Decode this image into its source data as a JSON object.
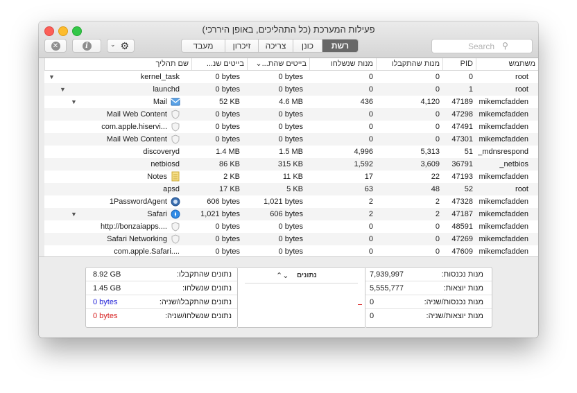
{
  "window": {
    "title": "פעילות המערכת (כל התהליכים, באופן היררכי)"
  },
  "toolbar": {
    "stop_icon": "x-circle-icon",
    "info_icon": "info-icon",
    "action_icon": "gear-icon",
    "tabs": [
      "מעבד",
      "זיכרון",
      "צריכה",
      "כונן",
      "רשת"
    ],
    "active_tab": "רשת",
    "search_placeholder": "Search"
  },
  "table": {
    "columns": [
      "שם תהליך",
      "בייטים שנ...",
      "בייטים שהת...",
      "מנות שנשלחו",
      "מנות שהתקבלו",
      "PID",
      "משתמש"
    ],
    "rows": [
      {
        "name": "kernel_task",
        "sent_bytes": "0 bytes",
        "recv_bytes": "0 bytes",
        "pkts_sent": "0",
        "pkts_recv": "0",
        "pid": "0",
        "user": "root"
      },
      {
        "name": "launchd",
        "sent_bytes": "0 bytes",
        "recv_bytes": "0 bytes",
        "pkts_sent": "0",
        "pkts_recv": "0",
        "pid": "1",
        "user": "root"
      },
      {
        "name": "Mail",
        "sent_bytes": "52 KB",
        "recv_bytes": "4.6 MB",
        "pkts_sent": "436",
        "pkts_recv": "4,120",
        "pid": "47189",
        "user": "mikemcfadden"
      },
      {
        "name": "Mail Web Content",
        "sent_bytes": "0 bytes",
        "recv_bytes": "0 bytes",
        "pkts_sent": "0",
        "pkts_recv": "0",
        "pid": "47298",
        "user": "mikemcfadden"
      },
      {
        "name": "com.apple.hiservi...",
        "sent_bytes": "0 bytes",
        "recv_bytes": "0 bytes",
        "pkts_sent": "0",
        "pkts_recv": "0",
        "pid": "47491",
        "user": "mikemcfadden"
      },
      {
        "name": "Mail Web Content",
        "sent_bytes": "0 bytes",
        "recv_bytes": "0 bytes",
        "pkts_sent": "0",
        "pkts_recv": "0",
        "pid": "47301",
        "user": "mikemcfadden"
      },
      {
        "name": "discoveryd",
        "sent_bytes": "1.4 MB",
        "recv_bytes": "1.5 MB",
        "pkts_sent": "4,996",
        "pkts_recv": "5,313",
        "pid": "51",
        "user": "_mdnsrespond"
      },
      {
        "name": "netbiosd",
        "sent_bytes": "86 KB",
        "recv_bytes": "315 KB",
        "pkts_sent": "1,592",
        "pkts_recv": "3,609",
        "pid": "36791",
        "user": "_netbios"
      },
      {
        "name": "Notes",
        "sent_bytes": "2 KB",
        "recv_bytes": "11 KB",
        "pkts_sent": "17",
        "pkts_recv": "22",
        "pid": "47193",
        "user": "mikemcfadden"
      },
      {
        "name": "apsd",
        "sent_bytes": "17 KB",
        "recv_bytes": "5 KB",
        "pkts_sent": "63",
        "pkts_recv": "48",
        "pid": "52",
        "user": "root"
      },
      {
        "name": "1PasswordAgent",
        "sent_bytes": "606 bytes",
        "recv_bytes": "1,021 bytes",
        "pkts_sent": "2",
        "pkts_recv": "2",
        "pid": "47328",
        "user": "mikemcfadden"
      },
      {
        "name": "Safari",
        "sent_bytes": "1,021 bytes",
        "recv_bytes": "606 bytes",
        "pkts_sent": "2",
        "pkts_recv": "2",
        "pid": "47187",
        "user": "mikemcfadden"
      },
      {
        "name": "http://bonzaiapps....",
        "sent_bytes": "0 bytes",
        "recv_bytes": "0 bytes",
        "pkts_sent": "0",
        "pkts_recv": "0",
        "pid": "48591",
        "user": "mikemcfadden"
      },
      {
        "name": "Safari Networking",
        "sent_bytes": "0 bytes",
        "recv_bytes": "0 bytes",
        "pkts_sent": "0",
        "pkts_recv": "0",
        "pid": "47269",
        "user": "mikemcfadden"
      },
      {
        "name": "com.apple.Safari....",
        "sent_bytes": "0 bytes",
        "recv_bytes": "0 bytes",
        "pkts_sent": "0",
        "pkts_recv": "0",
        "pid": "47609",
        "user": "mikemcfadden"
      }
    ]
  },
  "summary": {
    "left": [
      {
        "label": "נתונים שהתקבלו:",
        "value": "8.92 GB",
        "color": "#1a1a1a"
      },
      {
        "label": "נתונים שנשלחו:",
        "value": "1.45 GB",
        "color": "#1a1a1a"
      },
      {
        "label": "נתונים שהתקבלו/שניה:",
        "value": "0 bytes",
        "color": "#1f1fd6"
      },
      {
        "label": "נתונים שנשלחו/שניה:",
        "value": "0 bytes",
        "color": "#d61f1f"
      }
    ],
    "graph_selector": "נתונים",
    "right": [
      {
        "label": "מנות נכנסות:",
        "value": "7,939,997"
      },
      {
        "label": "מנות יוצאות:",
        "value": "5,555,777"
      },
      {
        "label": "מנות נכנסות/שניה:",
        "value": "0"
      },
      {
        "label": "מנות יוצאות/שניה:",
        "value": "0"
      }
    ]
  }
}
